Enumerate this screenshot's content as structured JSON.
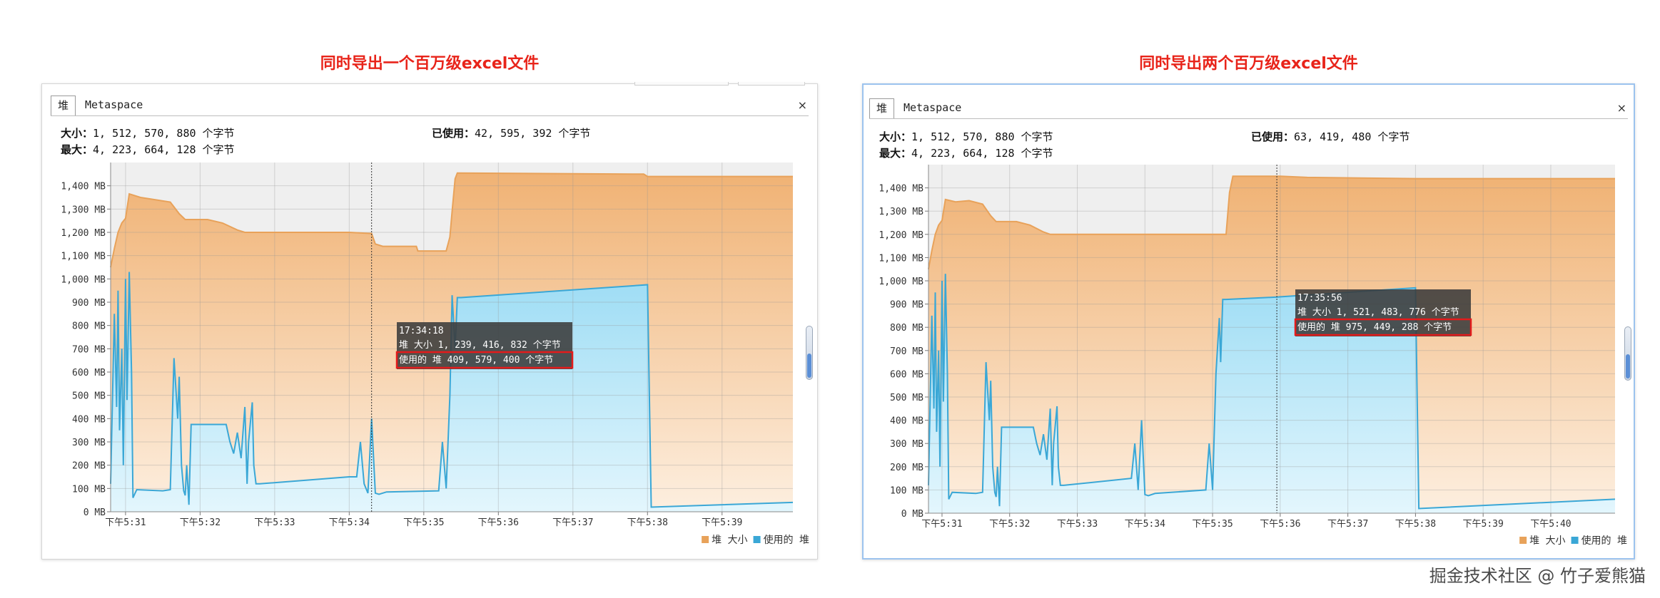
{
  "watermark": "掘金技术社区 @ 竹子爱熊猫",
  "panels": [
    {
      "caption": "同时导出一个百万级excel文件",
      "tab_heap": "堆",
      "tab_meta": "Metaspace",
      "close": "×",
      "size_label": "大小：",
      "size_value": "1, 512, 570, 880  个字节",
      "max_label": "最大：",
      "max_value": "4, 223, 664, 128  个字节",
      "used_label": "已使用：",
      "used_value": "42, 595, 392  个字节",
      "tooltip": {
        "time": "17:34:18",
        "heap_size_label": "堆 大小",
        "heap_size_value": "1, 239, 416, 832 个字节",
        "used_label": "使用的 堆",
        "used_value": "409, 579, 400 个字节"
      },
      "legend_heap": "堆 大小",
      "legend_used": "使用的 堆"
    },
    {
      "caption": "同时导出两个百万级excel文件",
      "tab_heap": "堆",
      "tab_meta": "Metaspace",
      "close": "×",
      "size_label": "大小：",
      "size_value": "1, 512, 570, 880  个字节",
      "max_label": "最大：",
      "max_value": "4, 223, 664, 128  个字节",
      "used_label": "已使用：",
      "used_value": "63, 419, 480  个字节",
      "tooltip": {
        "time": "17:35:56",
        "heap_size_label": "堆 大小",
        "heap_size_value": "1, 521, 483, 776 个字节",
        "used_label": "使用的 堆",
        "used_value": "975, 449, 288 个字节"
      },
      "legend_heap": "堆 大小",
      "legend_used": "使用的 堆"
    }
  ],
  "colors": {
    "caption": "#e8241a",
    "heap_size": "#e8a25a",
    "used_heap": "#3aa7d6",
    "tooltip_bg": "#3b3b3b",
    "tooltip_highlight": "#e41b1b"
  },
  "chart_data": [
    {
      "type": "area",
      "yunit": "MB",
      "ylim": [
        0,
        1500
      ],
      "xlim": [
        30.8,
        39.95
      ],
      "yticks": [
        "0 MB",
        "100 MB",
        "200 MB",
        "300 MB",
        "400 MB",
        "500 MB",
        "600 MB",
        "700 MB",
        "800 MB",
        "900 MB",
        "1,000 MB",
        "1,100 MB",
        "1,200 MB",
        "1,300 MB",
        "1,400 MB"
      ],
      "xticks": [
        {
          "label": "下午5:31",
          "x": 31
        },
        {
          "label": "下午5:32",
          "x": 32
        },
        {
          "label": "下午5:33",
          "x": 33
        },
        {
          "label": "下午5:34",
          "x": 34
        },
        {
          "label": "下午5:35",
          "x": 35
        },
        {
          "label": "下午5:36",
          "x": 36
        },
        {
          "label": "下午5:37",
          "x": 37
        },
        {
          "label": "下午5:38",
          "x": 38
        },
        {
          "label": "下午5:39",
          "x": 39
        }
      ],
      "grid": true,
      "legend": "bottom-right",
      "marker_x": 34.3,
      "series": [
        {
          "name": "堆 大小",
          "points": [
            [
              30.8,
              1050
            ],
            [
              30.85,
              1130
            ],
            [
              30.9,
              1200
            ],
            [
              30.95,
              1240
            ],
            [
              31.0,
              1260
            ],
            [
              31.05,
              1365
            ],
            [
              31.2,
              1350
            ],
            [
              31.4,
              1340
            ],
            [
              31.6,
              1330
            ],
            [
              31.72,
              1280
            ],
            [
              31.8,
              1255
            ],
            [
              32.1,
              1255
            ],
            [
              32.3,
              1240
            ],
            [
              32.5,
              1210
            ],
            [
              32.6,
              1200
            ],
            [
              34.0,
              1200
            ],
            [
              34.3,
              1195
            ],
            [
              34.35,
              1150
            ],
            [
              34.45,
              1140
            ],
            [
              34.9,
              1140
            ],
            [
              34.92,
              1120
            ],
            [
              35.3,
              1120
            ],
            [
              35.35,
              1180
            ],
            [
              35.38,
              1290
            ],
            [
              35.42,
              1430
            ],
            [
              35.45,
              1455
            ],
            [
              37.8,
              1450
            ],
            [
              37.95,
              1450
            ],
            [
              38.0,
              1440
            ],
            [
              39.95,
              1440
            ]
          ]
        },
        {
          "name": "使用的 堆",
          "points": [
            [
              30.8,
              120
            ],
            [
              30.85,
              850
            ],
            [
              30.88,
              450
            ],
            [
              30.9,
              950
            ],
            [
              30.92,
              350
            ],
            [
              30.95,
              700
            ],
            [
              30.97,
              200
            ],
            [
              31.0,
              1000
            ],
            [
              31.02,
              480
            ],
            [
              31.05,
              1030
            ],
            [
              31.08,
              600
            ],
            [
              31.1,
              60
            ],
            [
              31.15,
              95
            ],
            [
              31.5,
              90
            ],
            [
              31.6,
              95
            ],
            [
              31.65,
              660
            ],
            [
              31.7,
              400
            ],
            [
              31.72,
              580
            ],
            [
              31.75,
              200
            ],
            [
              31.78,
              90
            ],
            [
              31.8,
              70
            ],
            [
              31.82,
              200
            ],
            [
              31.85,
              30
            ],
            [
              31.88,
              375
            ],
            [
              32.35,
              375
            ],
            [
              32.4,
              300
            ],
            [
              32.45,
              250
            ],
            [
              32.5,
              340
            ],
            [
              32.55,
              230
            ],
            [
              32.6,
              450
            ],
            [
              32.63,
              120
            ],
            [
              32.65,
              300
            ],
            [
              32.7,
              470
            ],
            [
              32.72,
              200
            ],
            [
              32.75,
              120
            ],
            [
              32.8,
              120
            ],
            [
              34.0,
              150
            ],
            [
              34.1,
              150
            ],
            [
              34.15,
              300
            ],
            [
              34.2,
              120
            ],
            [
              34.25,
              80
            ],
            [
              34.3,
              400
            ],
            [
              34.35,
              80
            ],
            [
              34.4,
              75
            ],
            [
              34.5,
              85
            ],
            [
              35.2,
              90
            ],
            [
              35.25,
              300
            ],
            [
              35.3,
              100
            ],
            [
              35.35,
              500
            ],
            [
              35.38,
              930
            ],
            [
              35.42,
              700
            ],
            [
              35.45,
              920
            ],
            [
              35.5,
              920
            ],
            [
              38.0,
              975
            ],
            [
              38.05,
              20
            ],
            [
              39.95,
              40
            ]
          ]
        }
      ]
    },
    {
      "type": "area",
      "yunit": "MB",
      "ylim": [
        0,
        1500
      ],
      "xlim": [
        30.8,
        40.95
      ],
      "yticks": [
        "0 MB",
        "100 MB",
        "200 MB",
        "300 MB",
        "400 MB",
        "500 MB",
        "600 MB",
        "700 MB",
        "800 MB",
        "900 MB",
        "1,000 MB",
        "1,100 MB",
        "1,200 MB",
        "1,300 MB",
        "1,400 MB"
      ],
      "xticks": [
        {
          "label": "下午5:31",
          "x": 31
        },
        {
          "label": "下午5:32",
          "x": 32
        },
        {
          "label": "下午5:33",
          "x": 33
        },
        {
          "label": "下午5:34",
          "x": 34
        },
        {
          "label": "下午5:35",
          "x": 35
        },
        {
          "label": "下午5:36",
          "x": 36
        },
        {
          "label": "下午5:37",
          "x": 37
        },
        {
          "label": "下午5:38",
          "x": 38
        },
        {
          "label": "下午5:39",
          "x": 39
        },
        {
          "label": "下午5:40",
          "x": 40
        }
      ],
      "grid": true,
      "legend": "bottom-right",
      "marker_x": 35.95,
      "series": [
        {
          "name": "堆 大小",
          "points": [
            [
              30.8,
              1050
            ],
            [
              30.85,
              1130
            ],
            [
              30.9,
              1200
            ],
            [
              30.95,
              1240
            ],
            [
              31.0,
              1260
            ],
            [
              31.05,
              1350
            ],
            [
              31.2,
              1340
            ],
            [
              31.4,
              1345
            ],
            [
              31.6,
              1330
            ],
            [
              31.72,
              1280
            ],
            [
              31.8,
              1255
            ],
            [
              32.1,
              1255
            ],
            [
              32.3,
              1240
            ],
            [
              32.5,
              1210
            ],
            [
              32.6,
              1200
            ],
            [
              35.1,
              1200
            ],
            [
              35.2,
              1200
            ],
            [
              35.25,
              1380
            ],
            [
              35.3,
              1450
            ],
            [
              36.0,
              1450
            ],
            [
              36.4,
              1445
            ],
            [
              38.0,
              1440
            ],
            [
              40.95,
              1440
            ]
          ]
        },
        {
          "name": "使用的 堆",
          "points": [
            [
              30.8,
              120
            ],
            [
              30.85,
              850
            ],
            [
              30.88,
              450
            ],
            [
              30.9,
              950
            ],
            [
              30.92,
              350
            ],
            [
              30.95,
              700
            ],
            [
              30.97,
              200
            ],
            [
              31.0,
              1000
            ],
            [
              31.02,
              480
            ],
            [
              31.05,
              1030
            ],
            [
              31.08,
              600
            ],
            [
              31.1,
              60
            ],
            [
              31.15,
              90
            ],
            [
              31.5,
              85
            ],
            [
              31.6,
              90
            ],
            [
              31.65,
              650
            ],
            [
              31.7,
              400
            ],
            [
              31.72,
              570
            ],
            [
              31.75,
              200
            ],
            [
              31.78,
              90
            ],
            [
              31.8,
              70
            ],
            [
              31.82,
              200
            ],
            [
              31.85,
              30
            ],
            [
              31.88,
              370
            ],
            [
              32.35,
              370
            ],
            [
              32.4,
              300
            ],
            [
              32.45,
              250
            ],
            [
              32.5,
              340
            ],
            [
              32.55,
              230
            ],
            [
              32.6,
              450
            ],
            [
              32.63,
              120
            ],
            [
              32.65,
              300
            ],
            [
              32.7,
              460
            ],
            [
              32.72,
              200
            ],
            [
              32.75,
              120
            ],
            [
              32.8,
              120
            ],
            [
              33.8,
              150
            ],
            [
              33.85,
              300
            ],
            [
              33.9,
              100
            ],
            [
              33.95,
              400
            ],
            [
              34.0,
              80
            ],
            [
              34.05,
              75
            ],
            [
              34.15,
              85
            ],
            [
              34.9,
              100
            ],
            [
              34.95,
              300
            ],
            [
              35.0,
              100
            ],
            [
              35.05,
              600
            ],
            [
              35.1,
              840
            ],
            [
              35.12,
              650
            ],
            [
              35.15,
              920
            ],
            [
              35.2,
              920
            ],
            [
              35.95,
              930
            ],
            [
              38.0,
              970
            ],
            [
              38.05,
              20
            ],
            [
              40.95,
              60
            ]
          ]
        }
      ]
    }
  ]
}
